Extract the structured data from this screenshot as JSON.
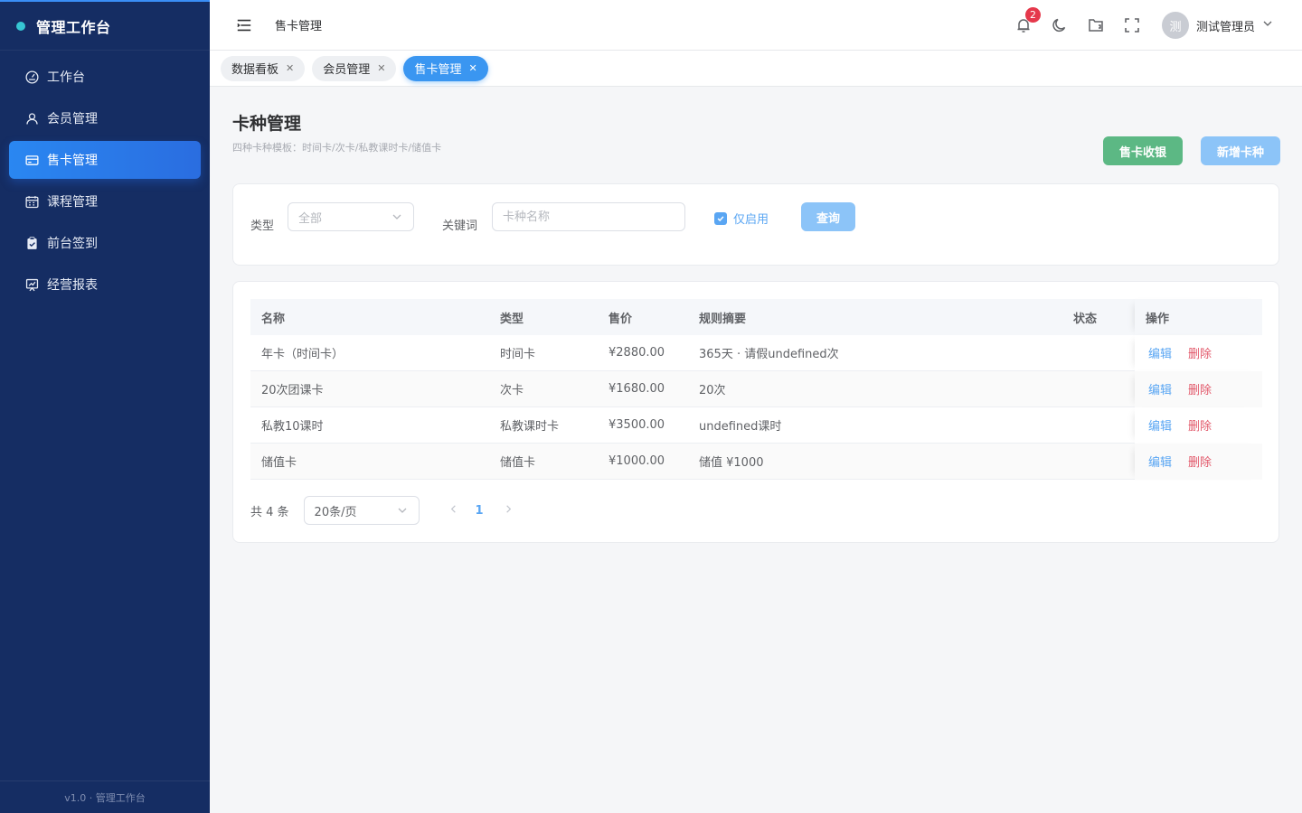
{
  "brand": {
    "title": "管理工作台"
  },
  "sidebar": {
    "items": [
      {
        "label": "工作台",
        "icon": "dashboard-icon",
        "active": false
      },
      {
        "label": "会员管理",
        "icon": "user-icon",
        "active": false
      },
      {
        "label": "售卡管理",
        "icon": "card-icon",
        "active": true
      },
      {
        "label": "课程管理",
        "icon": "calendar-icon",
        "active": false
      },
      {
        "label": "前台签到",
        "icon": "checkin-icon",
        "active": false
      },
      {
        "label": "经营报表",
        "icon": "report-icon",
        "active": false
      }
    ],
    "footer": "v1.0 · 管理工作台"
  },
  "header": {
    "title": "售卡管理",
    "notification_count": "2",
    "user": {
      "avatar_text": "测",
      "name": "测试管理员"
    }
  },
  "tabs": [
    {
      "label": "数据看板",
      "active": false
    },
    {
      "label": "会员管理",
      "active": false
    },
    {
      "label": "售卡管理",
      "active": true
    }
  ],
  "page": {
    "title": "卡种管理",
    "description": "四种卡种模板：时间卡/次卡/私教课时卡/储值卡",
    "btn_sell": "售卡收银",
    "btn_add": "新增卡种"
  },
  "filters": {
    "type_label": "类型",
    "type_value": "全部",
    "keyword_label": "关键词",
    "keyword_placeholder": "卡种名称",
    "enabled_only_label": "仅启用",
    "enabled_only_checked": true,
    "query_button": "查询"
  },
  "table": {
    "columns": [
      "名称",
      "类型",
      "售价",
      "规则摘要",
      "状态",
      "操作"
    ],
    "rows": [
      {
        "name": "年卡（时间卡）",
        "type": "时间卡",
        "price": "¥2880.00",
        "rule": "365天 · 请假undefined次",
        "status": "",
        "edit": "编辑",
        "del": "删除"
      },
      {
        "name": "20次团课卡",
        "type": "次卡",
        "price": "¥1680.00",
        "rule": "20次",
        "status": "",
        "edit": "编辑",
        "del": "删除"
      },
      {
        "name": "私教10课时",
        "type": "私教课时卡",
        "price": "¥3500.00",
        "rule": "undefined课时",
        "status": "",
        "edit": "编辑",
        "del": "删除"
      },
      {
        "name": "储值卡",
        "type": "储值卡",
        "price": "¥1000.00",
        "rule": "储值 ¥1000",
        "status": "",
        "edit": "编辑",
        "del": "删除"
      }
    ]
  },
  "pagination": {
    "total": "共 4 条",
    "page_size": "20条/页",
    "current": "1"
  },
  "colors": {
    "sidebar_bg": "#152d63",
    "accent": "#3a96f1",
    "success": "#5cb884",
    "danger": "#e2586a"
  }
}
